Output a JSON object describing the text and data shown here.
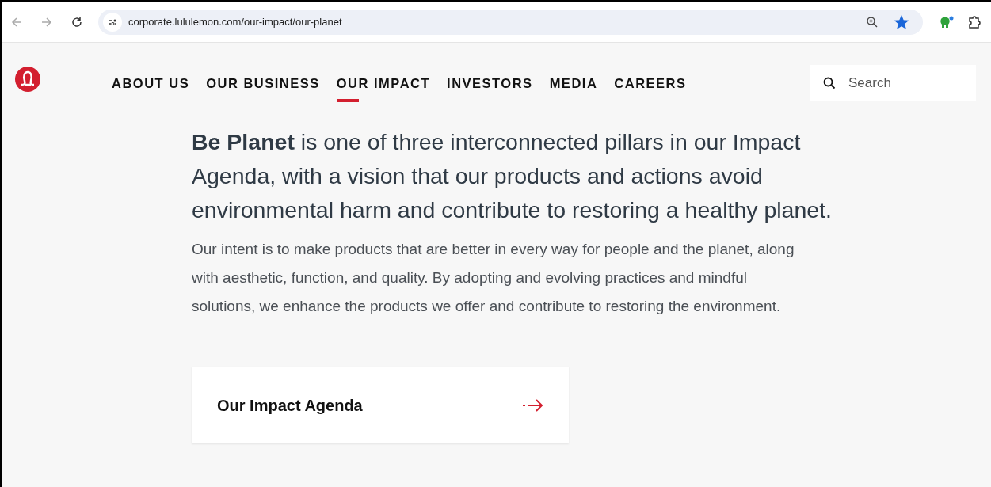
{
  "browser": {
    "url": "corporate.lululemon.com/our-impact/our-planet",
    "bookmarked": true
  },
  "nav": [
    {
      "label": "ABOUT US",
      "selected": false
    },
    {
      "label": "OUR BUSINESS",
      "selected": false
    },
    {
      "label": "OUR IMPACT",
      "selected": true
    },
    {
      "label": "INVESTORS",
      "selected": false
    },
    {
      "label": "MEDIA",
      "selected": false
    },
    {
      "label": "CAREERS",
      "selected": false
    }
  ],
  "search": {
    "placeholder": "Search"
  },
  "headline": "**Be Planet** is one of three interconnected pillars in our Impact Agenda, with a vision that our products and actions avoid environmental harm and contribute to restoring a healthy planet.",
  "body": "Our intent is to make products that are better in every way for people and the planet, along with aesthetic, function, and quality. By adopting and evolving practices and mindful solutions, we enhance the products we offer and contribute to restoring the environment.",
  "card": {
    "title": "Our Impact Agenda"
  }
}
